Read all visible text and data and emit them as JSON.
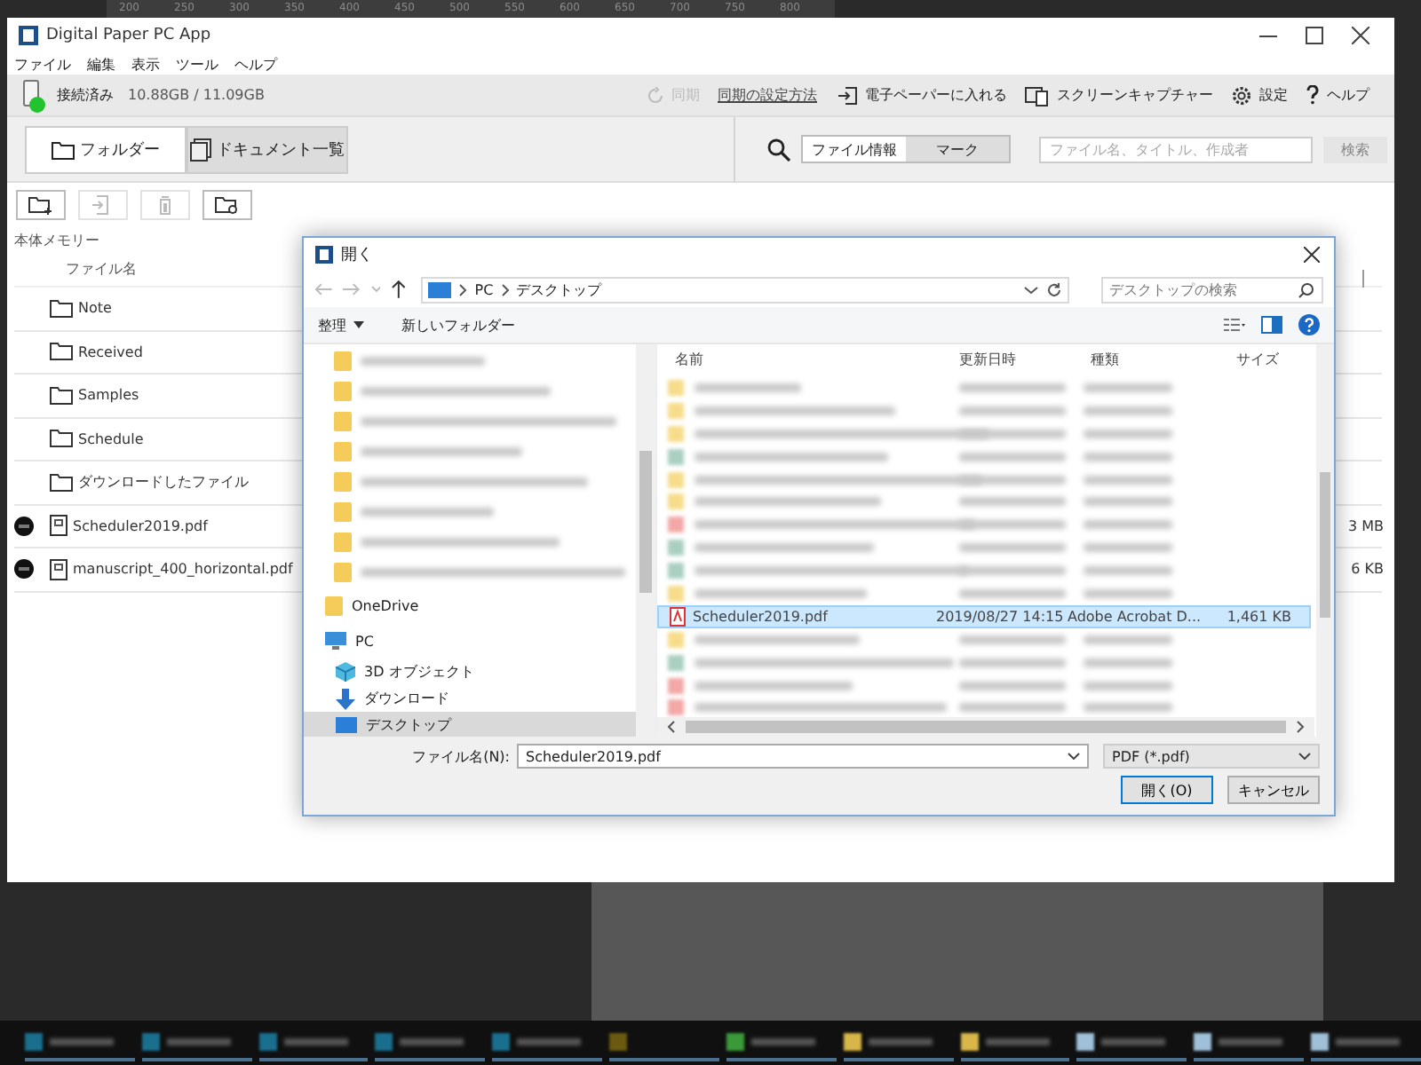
{
  "background": {
    "ruler_ticks": [
      "200",
      "250",
      "300",
      "350",
      "400",
      "450",
      "500",
      "550",
      "600",
      "650",
      "700",
      "750",
      "800"
    ]
  },
  "app_window": {
    "title": "Digital Paper PC App",
    "menu": [
      "ファイル",
      "編集",
      "表示",
      "ツール",
      "ヘルプ"
    ],
    "status": {
      "connected": true,
      "connection": "接続済み",
      "storage": "10.88GB / 11.09GB"
    },
    "toolbar_actions": [
      {
        "kind": "sync",
        "label": "同期",
        "disabled": true
      },
      {
        "kind": "link",
        "label": "同期の設定方法"
      },
      {
        "kind": "import",
        "label": "電子ペーパーに入れる"
      },
      {
        "kind": "capture",
        "label": "スクリーンキャプチャー"
      },
      {
        "kind": "settings",
        "label": "設定"
      },
      {
        "kind": "help",
        "label": "ヘルプ"
      }
    ],
    "view_tabs": [
      {
        "kind": "folder",
        "label": "フォルダー",
        "selected": true
      },
      {
        "kind": "documents",
        "label": "ドキュメント一覧",
        "selected": false
      }
    ],
    "search": {
      "modes": [
        {
          "label": "ファイル情報",
          "selected": true
        },
        {
          "label": "マーク",
          "selected": false
        }
      ],
      "placeholder": "ファイル名、タイトル、作成者",
      "button": "検索"
    },
    "file_actions": [
      {
        "kind": "new-folder",
        "disabled": false
      },
      {
        "kind": "move",
        "disabled": true
      },
      {
        "kind": "delete",
        "disabled": true
      },
      {
        "kind": "folder-sync",
        "disabled": false
      }
    ],
    "storage_label": "本体メモリー",
    "file_list": {
      "column": "ファイル名",
      "items": [
        {
          "kind": "folder",
          "name": "Note",
          "new": false
        },
        {
          "kind": "folder",
          "name": "Received",
          "new": false
        },
        {
          "kind": "folder",
          "name": "Samples",
          "new": false
        },
        {
          "kind": "folder",
          "name": "Schedule",
          "new": false
        },
        {
          "kind": "folder",
          "name": "ダウンロードしたファイル",
          "new": false
        },
        {
          "kind": "pdf",
          "name": "Scheduler2019.pdf",
          "new": true,
          "size": "3 MB"
        },
        {
          "kind": "pdf",
          "name": "manuscript_400_horizontal.pdf",
          "new": true,
          "size": "6 KB"
        }
      ]
    }
  },
  "dialog": {
    "title": "開く",
    "path": [
      "PC",
      "デスクトップ"
    ],
    "search_placeholder": "デスクトップの検索",
    "organize": "整理",
    "new_folder": "新しいフォルダー",
    "nav_items": [
      {
        "kind": "blurred",
        "selected": false
      },
      {
        "kind": "blurred",
        "selected": false
      },
      {
        "kind": "blurred",
        "selected": false
      },
      {
        "kind": "blurred",
        "selected": false
      },
      {
        "kind": "blurred",
        "selected": false
      },
      {
        "kind": "blurred",
        "selected": false
      },
      {
        "kind": "blurred",
        "selected": false
      },
      {
        "kind": "blurred",
        "selected": false
      },
      {
        "kind": "onedrive",
        "label": "OneDrive",
        "selected": false
      },
      {
        "kind": "pc",
        "label": "PC",
        "selected": false
      },
      {
        "kind": "objects",
        "label": "3D オブジェクト",
        "selected": false
      },
      {
        "kind": "downloads",
        "label": "ダウンロード",
        "selected": false
      },
      {
        "kind": "desktop",
        "label": "デスクトップ",
        "selected": true
      }
    ],
    "columns": [
      "名前",
      "更新日時",
      "種類",
      "サイズ"
    ],
    "files": [
      {
        "kind": "blurred-folder",
        "selected": false
      },
      {
        "kind": "blurred-folder",
        "selected": false
      },
      {
        "kind": "blurred-folder",
        "selected": false
      },
      {
        "kind": "blurred-file",
        "selected": false
      },
      {
        "kind": "blurred-folder",
        "selected": false
      },
      {
        "kind": "blurred-folder",
        "selected": false
      },
      {
        "kind": "blurred-pdf",
        "selected": false
      },
      {
        "kind": "blurred-file",
        "selected": false
      },
      {
        "kind": "blurred-file",
        "selected": false
      },
      {
        "kind": "blurred-folder",
        "selected": false
      },
      {
        "kind": "pdf",
        "name": "Scheduler2019.pdf",
        "modified": "2019/08/27 14:15",
        "type": "Adobe Acrobat D...",
        "size": "1,461 KB",
        "selected": true
      },
      {
        "kind": "blurred-folder",
        "selected": false
      },
      {
        "kind": "blurred-file",
        "selected": false
      },
      {
        "kind": "blurred-pdf",
        "selected": false
      },
      {
        "kind": "blurred-pdf",
        "selected": false
      }
    ],
    "filename_label": "ファイル名(N):",
    "filename": "Scheduler2019.pdf",
    "filter": "PDF (*.pdf)",
    "buttons": [
      "開く(O)",
      "キャンセル"
    ]
  },
  "taskbar": {
    "items": [
      {
        "kind": "window"
      },
      {
        "kind": "window"
      },
      {
        "kind": "window"
      },
      {
        "kind": "window"
      },
      {
        "kind": "window"
      },
      {
        "kind": "app"
      },
      {
        "kind": "browser"
      },
      {
        "kind": "folder"
      },
      {
        "kind": "folder"
      },
      {
        "kind": "document"
      },
      {
        "kind": "document"
      },
      {
        "kind": "document"
      }
    ]
  }
}
